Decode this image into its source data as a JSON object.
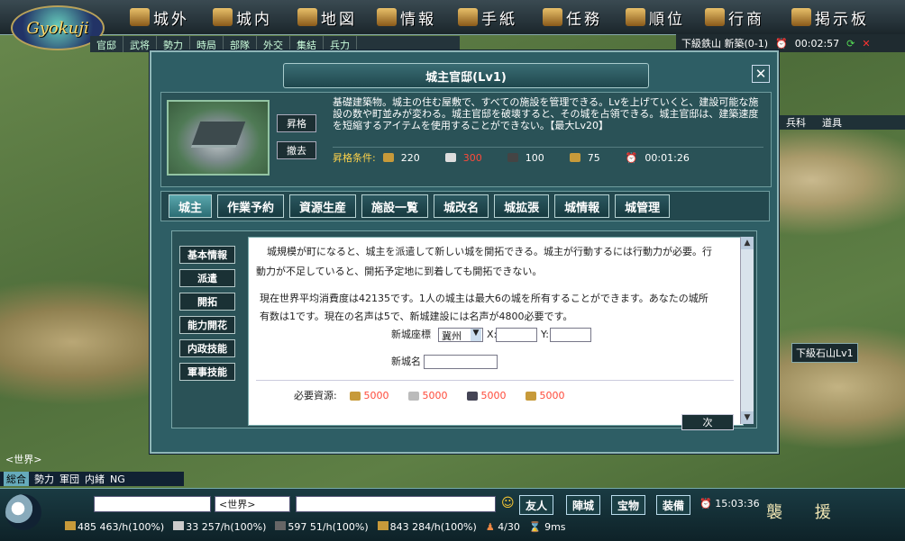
{
  "top_nav": {
    "logo": "Gyokuji",
    "items": [
      "城外",
      "城内",
      "地図",
      "情報",
      "手紙",
      "任務",
      "順位",
      "行商",
      "掲示板"
    ],
    "sub_items": [
      "官邸",
      "武将",
      "勢力",
      "時局",
      "部隊",
      "外交",
      "集結",
      "兵力"
    ]
  },
  "top_status": {
    "location": "下級鉄山 新築(0-1)",
    "time": "00:02:57"
  },
  "right_strip": {
    "items": [
      "兵科",
      "道具"
    ]
  },
  "map_label": "下級石山Lv1",
  "dialog": {
    "title": "城主官邸(Lv1)",
    "upgrade_btn": "昇格",
    "remove_btn": "撤去",
    "description": "基礎建築物。城主の住む屋敷で、すべての施設を管理できる。Lvを上げていくと、建設可能な施設の数や町並みが変わる。城主官邸を破壊すると、その城を占領できる。城主官邸は、建築速度を短縮するアイテムを使用することができない。【最大Lv20】",
    "cost_label": "昇格条件:",
    "costs": [
      "220",
      "300",
      "100",
      "75",
      "00:01:26"
    ],
    "tabs": [
      "城主",
      "作業予約",
      "資源生産",
      "施設一覧",
      "城改名",
      "城拡張",
      "城情報",
      "城管理"
    ],
    "left_menu": [
      "基本情報",
      "派遣",
      "開拓",
      "能力開花",
      "内政技能",
      "軍事技能"
    ],
    "panel": {
      "line1": "城規模が町になると、城主を派遣して新しい城を開拓できる。城主が行動するには行動力が必要。行",
      "line2": "動力が不足していると、開拓予定地に到着しても開拓できない。",
      "line3": "現在世界平均消費度は42135です。1人の城主は最大6の城を所有することができます。あなたの城所",
      "line4": "有数は1です。現在の名声は5で、新城建設には名声が4800必要です。",
      "coord_label": "新城座標",
      "coord_select": "冀州",
      "x_label": "X:",
      "y_label": "Y:",
      "name_label": "新城名",
      "req_label": "必要資源:",
      "req": [
        "5000",
        "5000",
        "5000",
        "5000"
      ],
      "next_btn": "次"
    }
  },
  "chat": {
    "label": "<世界>",
    "tabs": [
      "総合",
      "勢力",
      "軍団",
      "内緒",
      "NG"
    ],
    "channel": "<世界>"
  },
  "bottom": {
    "buttons": [
      "友人",
      "陣城",
      "宝物",
      "装備"
    ],
    "clock": "15:03:36",
    "resources": [
      "485 463/h(100%)",
      "33 257/h(100%)",
      "597 51/h(100%)",
      "843 284/h(100%)"
    ],
    "soldiers": "4/30",
    "ping": "9ms",
    "gear_labels": [
      "襲",
      "援"
    ]
  }
}
